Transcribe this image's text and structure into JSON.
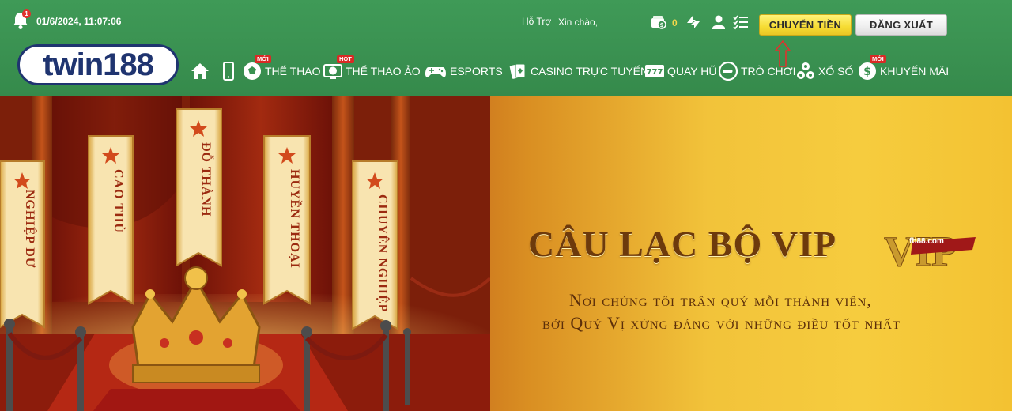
{
  "header": {
    "notification_count": "1",
    "datetime": "01/6/2024, 11:07:06",
    "support_label": "Hỗ Trợ",
    "greeting": "Xin chào,",
    "balance": "0",
    "transfer_button": "CHUYỂN TIỀN",
    "logout_button": "ĐĂNG XUẤT"
  },
  "logo": {
    "text": "twin188"
  },
  "nav": {
    "items": [
      {
        "label": "",
        "icon": "home-icon"
      },
      {
        "label": "",
        "icon": "mobile-icon"
      },
      {
        "label": "THỂ THAO",
        "icon": "soccer-ball-icon",
        "tag": "MỚI"
      },
      {
        "label": "THỂ THAO ẢO",
        "icon": "virtual-sports-icon",
        "tag": "HOT"
      },
      {
        "label": "ESPORTS",
        "icon": "gamepad-icon"
      },
      {
        "label": "CASINO TRỰC TUYẾN",
        "icon": "cards-icon"
      },
      {
        "label": "QUAY HŨ",
        "icon": "slot-777-icon"
      },
      {
        "label": "TRÒ CHƠI",
        "icon": "game-icon"
      },
      {
        "label": "XỔ SỐ",
        "icon": "lottery-balls-icon"
      },
      {
        "label": "KHUYẾN MÃI",
        "icon": "dollar-coin-icon",
        "tag": "MỚI"
      }
    ]
  },
  "banner": {
    "banners_left": [
      "NGHIỆP DƯ",
      "CAO THỦ",
      "ĐỖ THÀNH",
      "HUYỀN THOẠI",
      "CHUYÊN NGHIỆP"
    ],
    "headline": "CÂU LẠC BỘ VIP",
    "vip_mark": "VIP",
    "vip_badge": "fb88.com",
    "line1": "Nơi chúng tôi trân quý mỗi thành viên,",
    "line2": "bởi Quý Vị xứng đáng với những điều tốt nhất"
  },
  "colors": {
    "header_green": "#3a9151",
    "transfer_yellow": "#f6dc33",
    "logo_navy": "#1f3470",
    "badge_red": "#d92a25",
    "banner_gold": "#f6cc3e"
  }
}
